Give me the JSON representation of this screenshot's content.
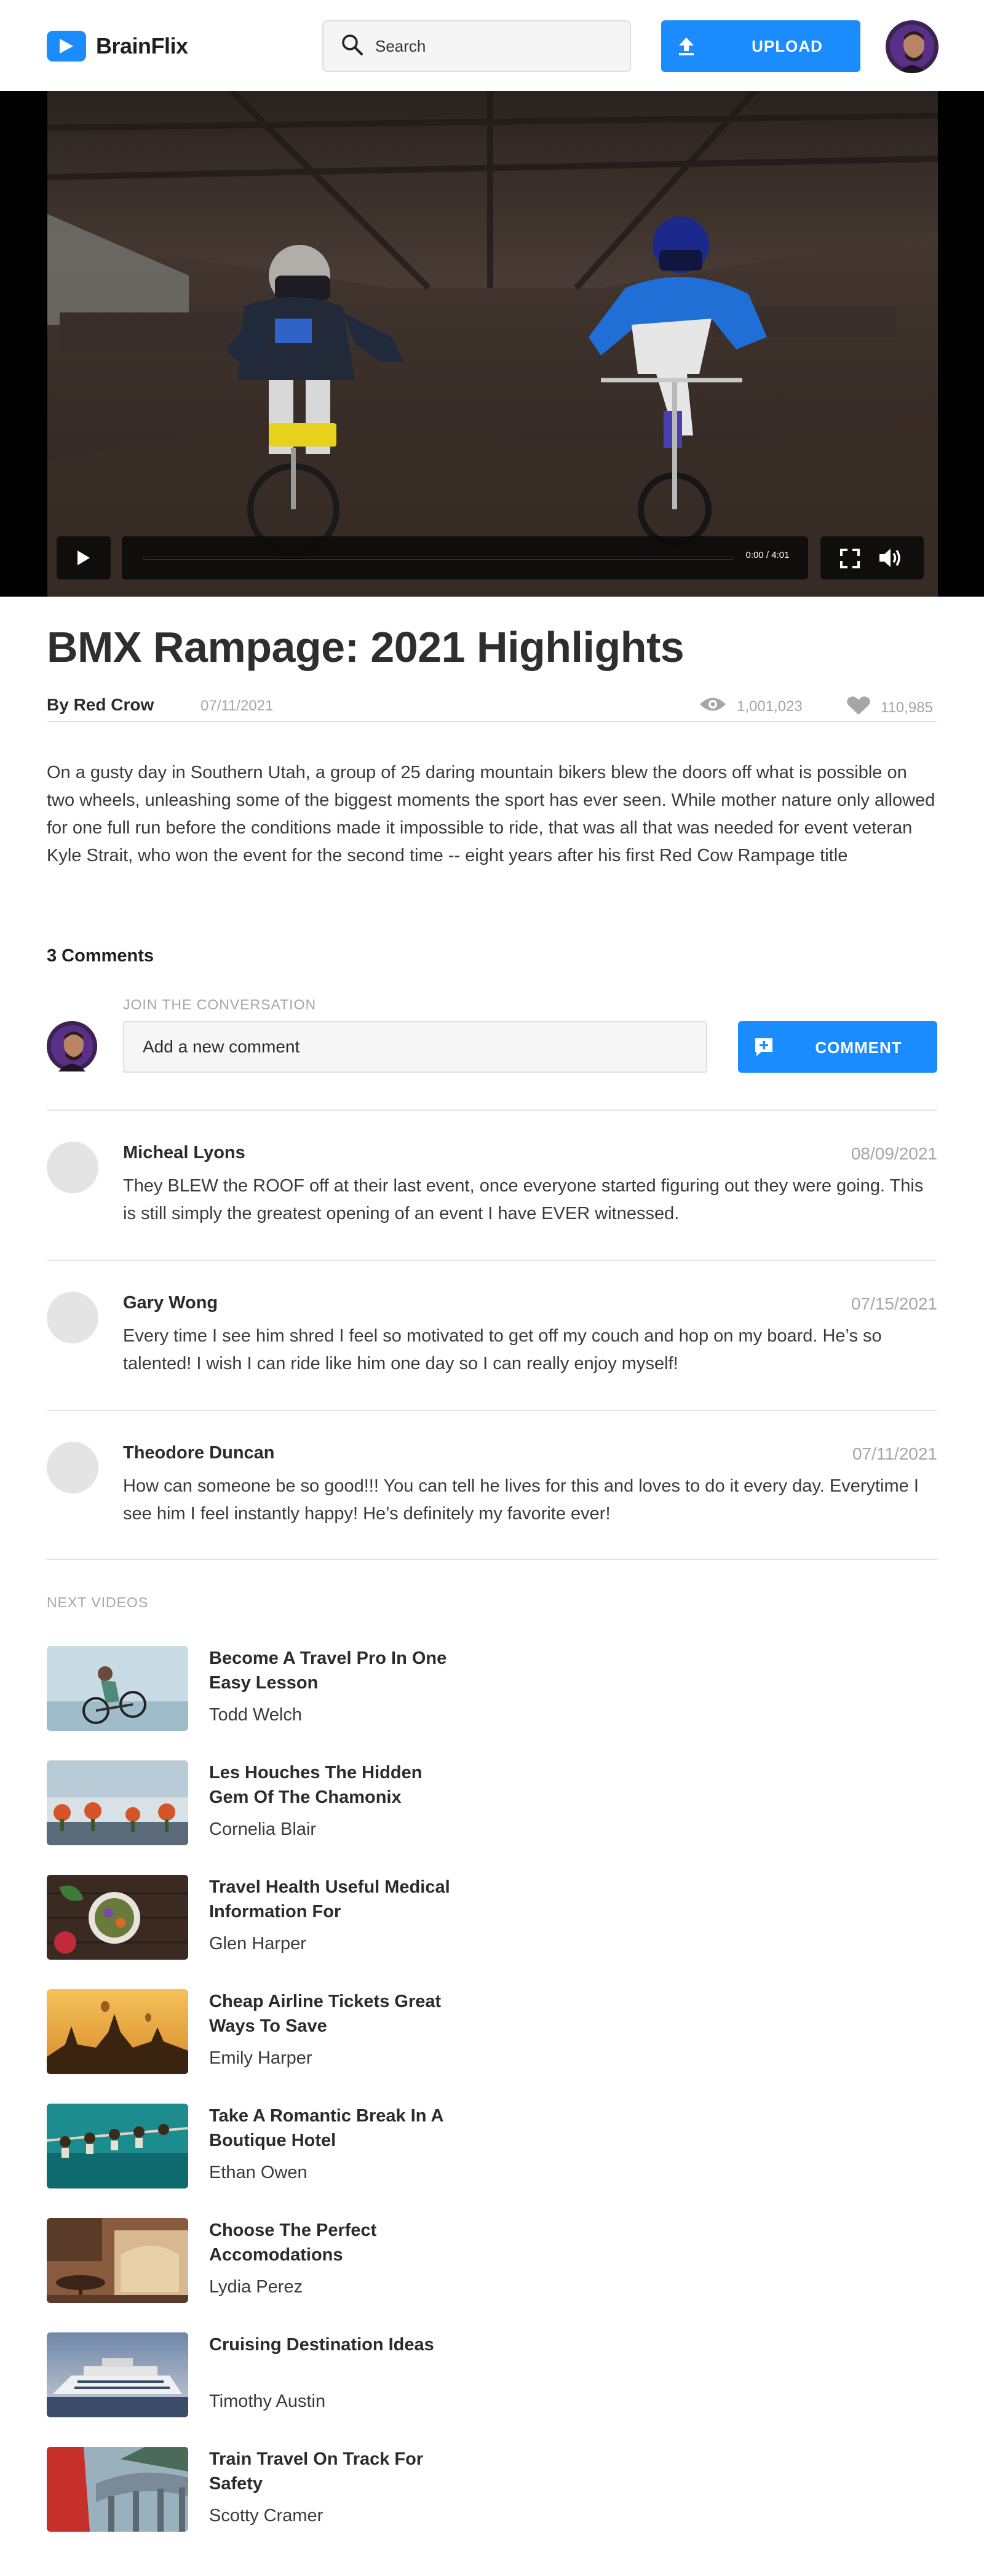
{
  "brand": {
    "name": "BrainFlix",
    "accent": "#1a8cff"
  },
  "header": {
    "search_placeholder": "Search",
    "upload_label": "UPLOAD"
  },
  "player": {
    "time": "0:00 / 4:01",
    "progress": 0
  },
  "video": {
    "title": "BMX Rampage: 2021 Highlights",
    "author": "By Red Crow",
    "date": "07/11/2021",
    "views": "1,001,023",
    "likes": "110,985",
    "description": "On a gusty day in Southern Utah, a group of 25 daring mountain bikers blew the doors off what is possible on two wheels, unleashing some of the biggest moments the sport has ever seen. While mother nature only allowed for one full run before the conditions made it impossible to ride, that was all that was needed for event veteran Kyle Strait, who won the event for the second time -- eight years after his first Red Cow Rampage title"
  },
  "comments_section": {
    "count_label": "3 Comments",
    "join_label": "JOIN THE CONVERSATION",
    "input_placeholder": "Add a new comment",
    "button_label": "COMMENT",
    "items": [
      {
        "name": "Micheal Lyons",
        "date": "08/09/2021",
        "text": "They BLEW the ROOF off at their last event, once everyone started figuring out they were going. This is still simply the greatest opening of an event I have EVER witnessed."
      },
      {
        "name": "Gary Wong",
        "date": "07/15/2021",
        "text": "Every time I see him shred I feel so motivated to get off my couch and hop on my board. He’s so talented! I wish I can ride like him one day so I can really enjoy myself!"
      },
      {
        "name": "Theodore Duncan",
        "date": "07/11/2021",
        "text": "How can someone be so good!!! You can tell he lives for this and loves to do it every day. Everytime I see him I feel instantly happy! He’s definitely my favorite ever!"
      }
    ]
  },
  "next_videos": {
    "label": "NEXT VIDEOS",
    "items": [
      {
        "title": "Become A Travel Pro In One Easy Lesson",
        "author": "Todd Welch",
        "thumb_colors": [
          "#c9dbe4",
          "#9fbccb"
        ]
      },
      {
        "title": "Les Houches The Hidden Gem Of The Chamonix",
        "author": "Cornelia Blair",
        "thumb_colors": [
          "#b9cbd6",
          "#d8e2e6"
        ]
      },
      {
        "title": "Travel Health Useful Medical Information For",
        "author": "Glen Harper",
        "thumb_colors": [
          "#3a2a22",
          "#5e3a2a"
        ]
      },
      {
        "title": "Cheap Airline Tickets Great Ways To Save",
        "author": "Emily Harper",
        "thumb_colors": [
          "#f2b14a",
          "#c9822a"
        ]
      },
      {
        "title": "Take A Romantic Break In A Boutique Hotel",
        "author": "Ethan Owen",
        "thumb_colors": [
          "#1d8c8e",
          "#0f6a70"
        ]
      },
      {
        "title": "Choose The Perfect Accomodations",
        "author": "Lydia Perez",
        "thumb_colors": [
          "#8a5a3e",
          "#d8b890"
        ]
      },
      {
        "title": "Cruising Destination Ideas",
        "author": "Timothy Austin",
        "thumb_colors": [
          "#6f87aa",
          "#c9cdd6"
        ]
      },
      {
        "title": "Train Travel On Track For Safety",
        "author": "Scotty Cramer",
        "thumb_colors": [
          "#c7302a",
          "#7a8a96"
        ]
      }
    ]
  }
}
